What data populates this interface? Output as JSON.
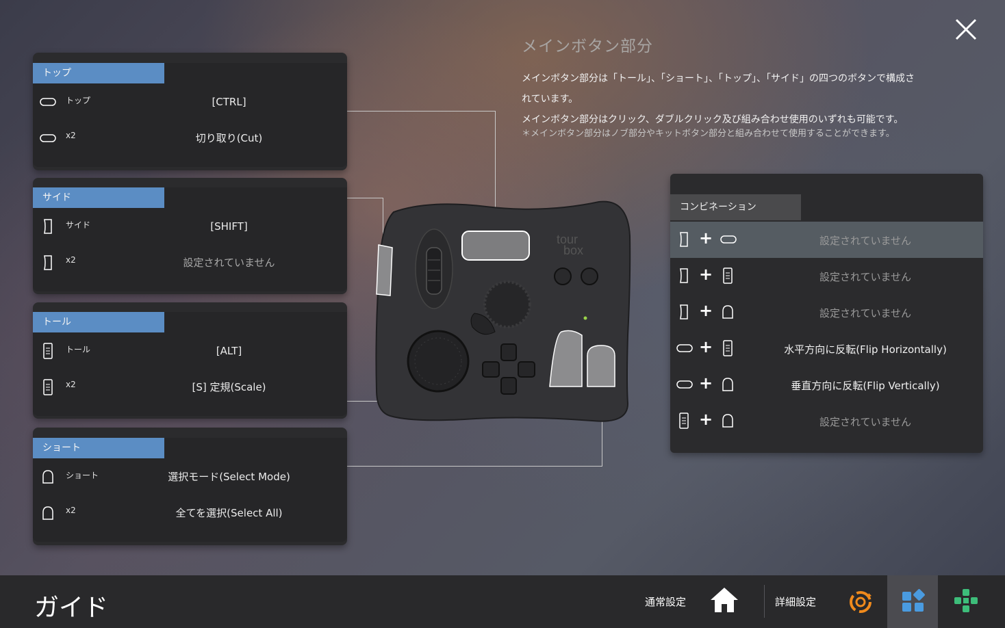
{
  "info": {
    "heading": "メインボタン部分",
    "line1": "メインボタン部分は「トール」、「ショート」、「トップ」、「サイド」の四つのボタンで構成さ",
    "line2": "れています。",
    "line3": "メインボタン部分はクリック、ダブルクリック及び組み合わせ使用のいずれも可能です。",
    "note": "＊メインボタン部分はノブ部分やキットボタン部分と組み合わせて使用することができます。"
  },
  "cards": [
    {
      "label": "トップ",
      "icon": "top-button-icon",
      "rows": [
        {
          "name": "トップ",
          "value": "[CTRL]",
          "unset": false
        },
        {
          "name": "x2",
          "value": "切り取り(Cut)",
          "unset": false
        }
      ]
    },
    {
      "label": "サイド",
      "icon": "side-button-icon",
      "rows": [
        {
          "name": "サイド",
          "value": "[SHIFT]",
          "unset": false
        },
        {
          "name": "x2",
          "value": "設定されていません",
          "unset": true
        }
      ]
    },
    {
      "label": "トール",
      "icon": "tall-button-icon",
      "rows": [
        {
          "name": "トール",
          "value": "[ALT]",
          "unset": false
        },
        {
          "name": "x2",
          "value": "[S] 定規(Scale)",
          "unset": false
        }
      ]
    },
    {
      "label": "ショート",
      "icon": "short-button-icon",
      "rows": [
        {
          "name": "ショート",
          "value": "選択モード(Select Mode)",
          "unset": false
        },
        {
          "name": "x2",
          "value": "全てを選択(Select All)",
          "unset": false
        }
      ]
    }
  ],
  "combo": {
    "label": "コンビネーション",
    "rows": [
      {
        "icon1": "side-button-icon",
        "icon2": "top-button-icon",
        "value": "設定されていません",
        "unset": true,
        "active": true
      },
      {
        "icon1": "side-button-icon",
        "icon2": "tall-button-icon",
        "value": "設定されていません",
        "unset": true,
        "active": false
      },
      {
        "icon1": "side-button-icon",
        "icon2": "short-button-icon",
        "value": "設定されていません",
        "unset": true,
        "active": false
      },
      {
        "icon1": "top-button-icon",
        "icon2": "tall-button-icon",
        "value": "水平方向に反転(Flip Horizontally)",
        "unset": false,
        "active": false
      },
      {
        "icon1": "top-button-icon",
        "icon2": "short-button-icon",
        "value": "垂直方向に反転(Flip Vertically)",
        "unset": false,
        "active": false
      },
      {
        "icon1": "tall-button-icon",
        "icon2": "short-button-icon",
        "value": "設定されていません",
        "unset": true,
        "active": false
      }
    ]
  },
  "device": {
    "logo_line1": "tour",
    "logo_line2": "box"
  },
  "bottom": {
    "title": "ガイド",
    "normal_settings": "通常設定",
    "advanced_settings": "詳細設定",
    "icons": [
      "home-icon",
      "gear-sync-icon",
      "grid-widget-icon",
      "gamepad-icon"
    ],
    "accent_orange": "#f08a1c",
    "accent_blue": "#4a9be0",
    "accent_green": "#3dbd7a"
  }
}
